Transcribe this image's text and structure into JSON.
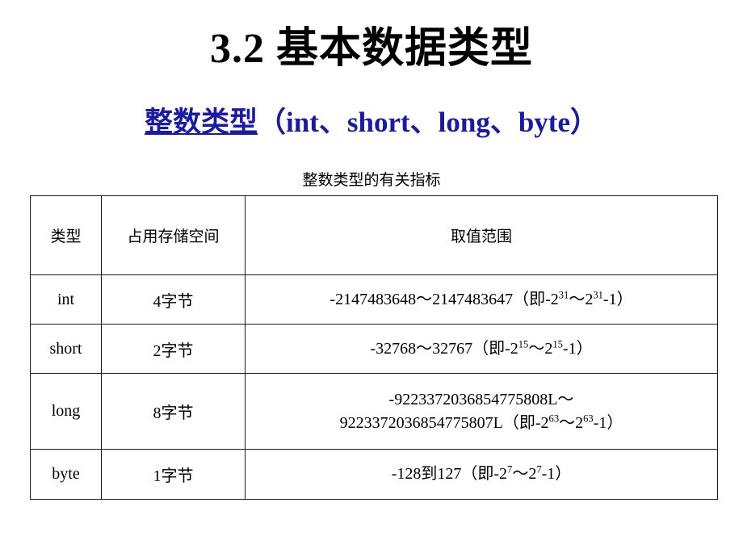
{
  "slide": {
    "title": "3.2 基本数据类型",
    "subtitle_cn": "整数类型",
    "subtitle_en": "（int、short、long、byte）",
    "accent_color": "#1a1aa8",
    "text_color": "#000000",
    "background_color": "#ffffff"
  },
  "table": {
    "caption": "整数类型的有关指标",
    "headers": [
      "类型",
      "占用存储空间",
      "取值范围"
    ],
    "rows": [
      {
        "type": "int",
        "storage": "4字节",
        "range_prefix": "-2147483648～2147483647（即-2",
        "range_exp1": "31",
        "range_mid": "～2",
        "range_exp2": "31",
        "range_suffix": "-1）",
        "range_line2_prefix": "",
        "range_plain": "-2147483648～2147483647（即-2^31～2^31-1）"
      },
      {
        "type": "short",
        "storage": "2字节",
        "range_prefix": "-32768～32767（即-2",
        "range_exp1": "15",
        "range_mid": "～2",
        "range_exp2": "15",
        "range_suffix": "-1）",
        "range_line2_prefix": "",
        "range_plain": "-32768～32767（即-2^15～2^15-1）"
      },
      {
        "type": "long",
        "storage": "8字节",
        "range_line1": "-9223372036854775808L～",
        "range_prefix": "9223372036854775807L（即-2",
        "range_exp1": "63",
        "range_mid": "～2",
        "range_exp2": "63",
        "range_suffix": "-1）",
        "range_plain": "-9223372036854775808L～9223372036854775807L（即-2^63～2^63-1）"
      },
      {
        "type": "byte",
        "storage": "1字节",
        "range_prefix": "-128到127（即-2",
        "range_exp1": "7",
        "range_mid": "～2",
        "range_exp2": "7",
        "range_suffix": "-1）",
        "range_line2_prefix": "",
        "range_plain": "-128到127（即-2^7～2^7-1）"
      }
    ]
  }
}
